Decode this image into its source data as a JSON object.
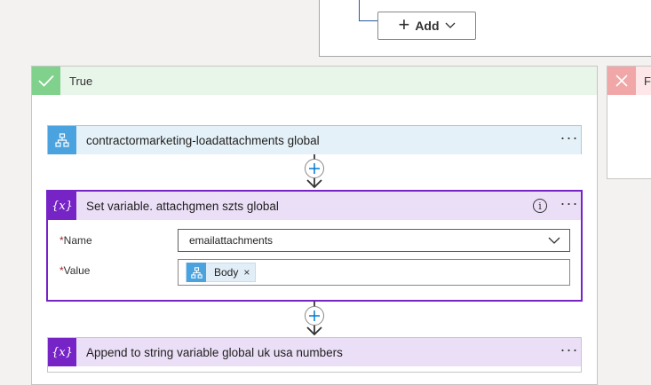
{
  "top": {
    "add_label": "Add"
  },
  "true_branch": {
    "label": "True"
  },
  "false_branch": {
    "label": "F"
  },
  "actions": [
    {
      "title": "contractormarketing-loadattachments global",
      "icon": "workflow-icon",
      "color": "#4aa3df"
    },
    {
      "title": "Set variable. attachgmen szts global",
      "icon": "variable-icon",
      "icon_text": "{x}",
      "color": "#7724c6",
      "fields": {
        "name": {
          "required_mark": "*",
          "label": "Name",
          "value": "emailattachments"
        },
        "value": {
          "required_mark": "*",
          "label": "Value",
          "token": "Body"
        }
      }
    },
    {
      "title": "Append to string variable global uk usa numbers",
      "icon": "variable-icon",
      "icon_text": "{x}",
      "color": "#7724c6"
    }
  ],
  "more_label": "···",
  "remove_token_label": "×",
  "info_label": "i",
  "colors": {
    "true_header": "#e8f5e9",
    "false_header": "#fde7e9",
    "accent": "#0078d4"
  }
}
